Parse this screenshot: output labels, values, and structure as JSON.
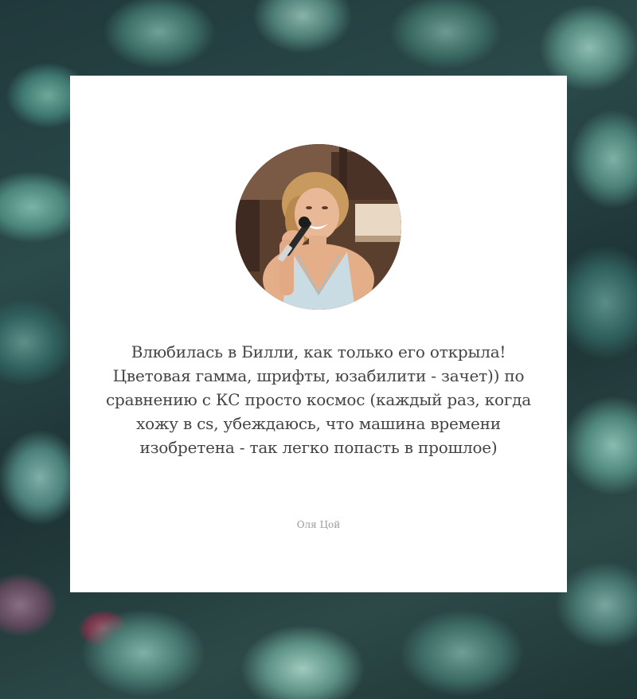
{
  "testimonial": {
    "quote": "Влюбилась в Билли, как только его открыла! Цветовая гамма, шрифты, юзабилити - зачет)) по сравнению с КС просто космос (каждый раз, когда хожу в cs, убеждаюсь, что машина времени изобретена - так легко попасть в прошлое)",
    "author": "Оля Цой"
  }
}
